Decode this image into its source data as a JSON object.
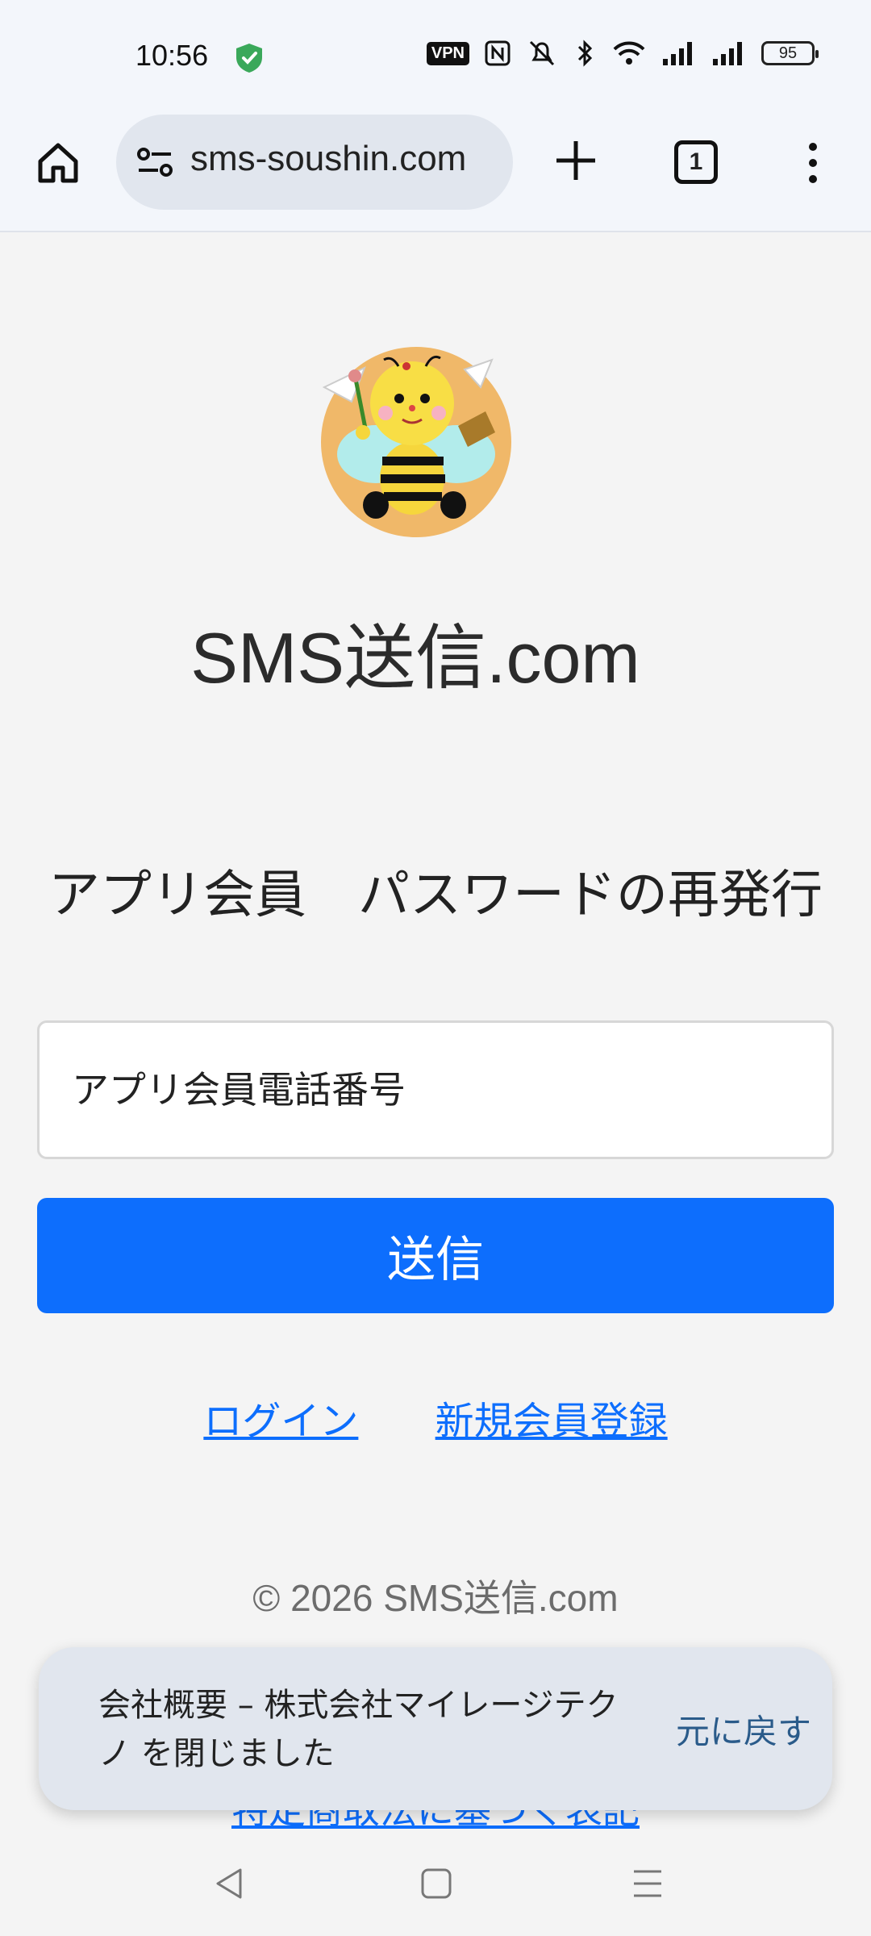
{
  "status_bar": {
    "time": "10:56",
    "vpn_label": "VPN",
    "battery": "95"
  },
  "browser": {
    "url": "sms-soushin.com",
    "tab_count": "1"
  },
  "page": {
    "site_title": "SMS送信.com",
    "heading": "アプリ会員　パスワードの再発行",
    "phone_placeholder": "アプリ会員電話番号",
    "submit_label": "送信",
    "login_link": "ログイン",
    "register_link": "新規会員登録",
    "footer": "© 2026 SMS送信.com",
    "partially_hidden_link": "特定商取法に基づく表記"
  },
  "snackbar": {
    "message": "会社概要 – 株式会社マイレージテクノ を閉じました",
    "action": "元に戻す"
  },
  "colors": {
    "primary": "#0d6efd",
    "chrome_bg": "#f3f6fb",
    "page_bg": "#f4f4f4"
  }
}
